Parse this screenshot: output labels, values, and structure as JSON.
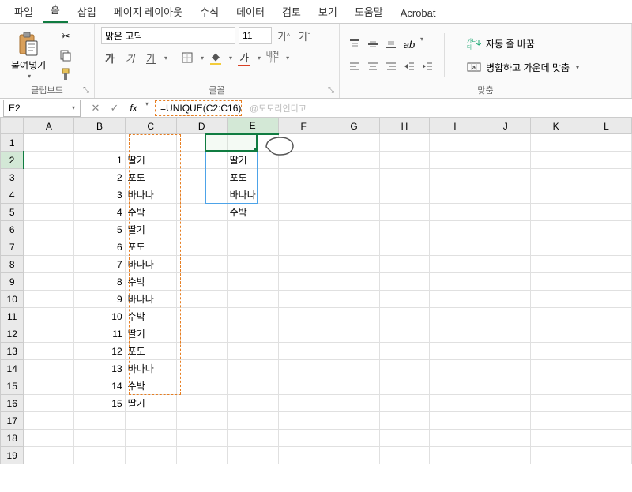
{
  "tabs": [
    "파일",
    "홈",
    "삽입",
    "페이지 레이아웃",
    "수식",
    "데이터",
    "검토",
    "보기",
    "도움말",
    "Acrobat"
  ],
  "active_tab_index": 1,
  "ribbon": {
    "clipboard": {
      "paste_label": "붙여넣기",
      "group_label": "클립보드"
    },
    "font": {
      "font_name": "맑은 고딕",
      "font_size": "11",
      "btn_bold": "가",
      "btn_italic": "가",
      "btn_underline": "가",
      "btn_increase": "가ˇ",
      "btn_decrease": "가ˇ",
      "btn_hanja": "내천",
      "group_label": "글꼴"
    },
    "align": {
      "wrap_label": "자동 줄 바꿈",
      "merge_label": "병합하고 가운데 맞춤",
      "group_label": "맞춤"
    }
  },
  "formula_bar": {
    "name_box": "E2",
    "fx": "fx",
    "formula": "=UNIQUE(C2:C16)",
    "watermark": "@도토리인디고"
  },
  "columns": [
    "A",
    "B",
    "C",
    "D",
    "E",
    "F",
    "G",
    "H",
    "I",
    "J",
    "K",
    "L"
  ],
  "row_count": 19,
  "selected_cell": "E2",
  "data_B": [
    "1",
    "2",
    "3",
    "4",
    "5",
    "6",
    "7",
    "8",
    "9",
    "10",
    "11",
    "12",
    "13",
    "14",
    "15"
  ],
  "data_C": [
    "딸기",
    "포도",
    "바나나",
    "수박",
    "딸기",
    "포도",
    "바나나",
    "수박",
    "바나나",
    "수박",
    "딸기",
    "포도",
    "바나나",
    "수박",
    "딸기"
  ],
  "data_E": [
    "딸기",
    "포도",
    "바나나",
    "수박"
  ],
  "chart_data": null
}
